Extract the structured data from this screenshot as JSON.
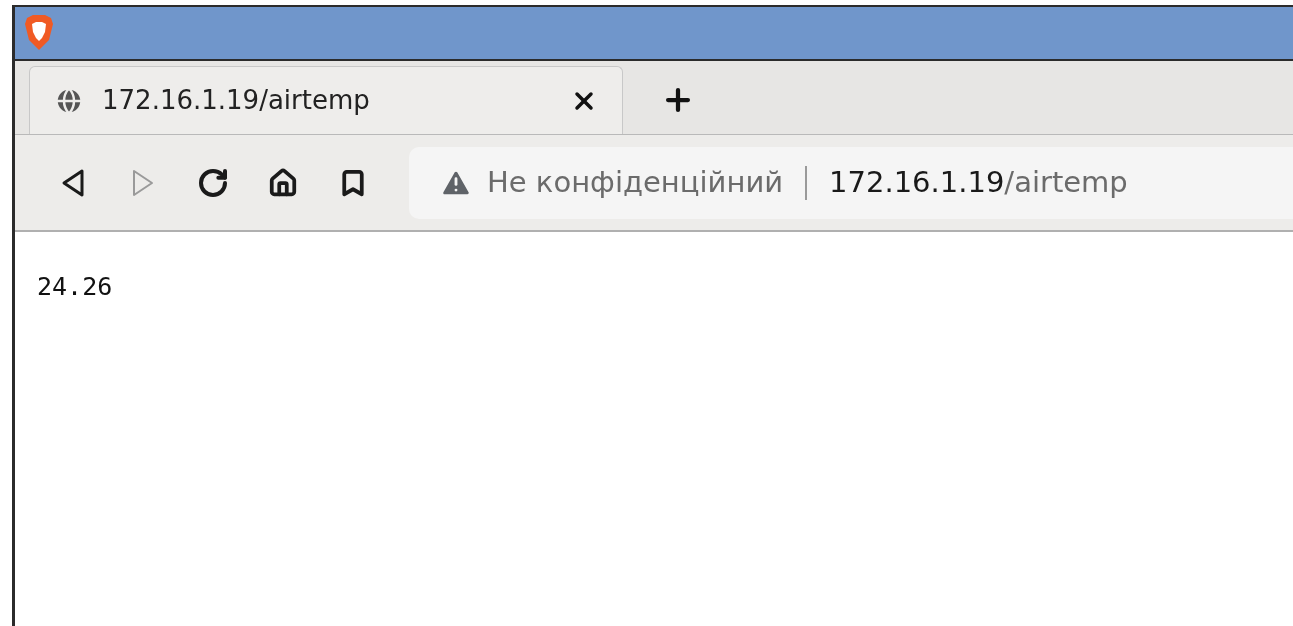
{
  "tabs": [
    {
      "title": "172.16.1.19/airtemp",
      "selected": true
    }
  ],
  "toolbar": {
    "buttons": [
      {
        "kind": "back",
        "disabled": false
      },
      {
        "kind": "forward",
        "disabled": true
      },
      {
        "kind": "reload",
        "disabled": false
      },
      {
        "kind": "home",
        "disabled": false
      },
      {
        "kind": "bookmark",
        "disabled": false
      }
    ]
  },
  "address_bar": {
    "security_label": "Не конфіденційний",
    "host": "172.16.1.19",
    "path": "/airtemp"
  },
  "page": {
    "text": "24.26"
  }
}
